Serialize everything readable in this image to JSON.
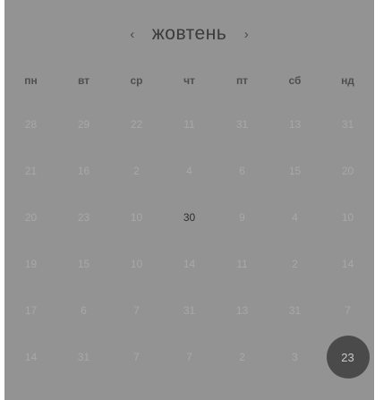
{
  "header": {
    "prev_label": "‹",
    "next_label": "›",
    "month": "жовтень"
  },
  "weekdays": [
    "пн",
    "вт",
    "ср",
    "чт",
    "пт",
    "сб",
    "нд"
  ],
  "days": [
    [
      "28",
      "29",
      "22",
      "11",
      "31",
      "13",
      "31"
    ],
    [
      "21",
      "16",
      "2",
      "4",
      "6",
      "15",
      "20"
    ],
    [
      "20",
      "23",
      "10",
      "30",
      "9",
      "4",
      "10"
    ],
    [
      "19",
      "15",
      "10",
      "14",
      "11",
      "2",
      "14"
    ],
    [
      "17",
      "6",
      "7",
      "31",
      "13",
      "31",
      "7"
    ],
    [
      "14",
      "31",
      "7",
      "7",
      "2",
      "3",
      "23"
    ]
  ],
  "active_day": "30",
  "selected_day": "23",
  "colors": {
    "background": "#939393",
    "selected_bubble": "#4a4a4a"
  }
}
